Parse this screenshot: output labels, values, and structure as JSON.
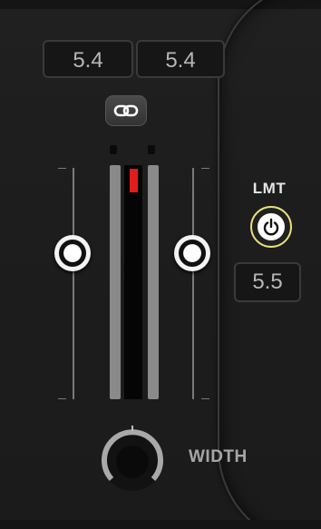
{
  "channels": {
    "left_value": "5.4",
    "right_value": "5.4",
    "link_icon": "chain-link-icon"
  },
  "limiter": {
    "label": "LMT",
    "power_icon": "power-icon",
    "power_state": "on",
    "value": "5.5",
    "accent_color": "#e9e07a"
  },
  "meter": {
    "peak_color": "#e21c1c"
  },
  "width": {
    "label": "WIDTH"
  }
}
